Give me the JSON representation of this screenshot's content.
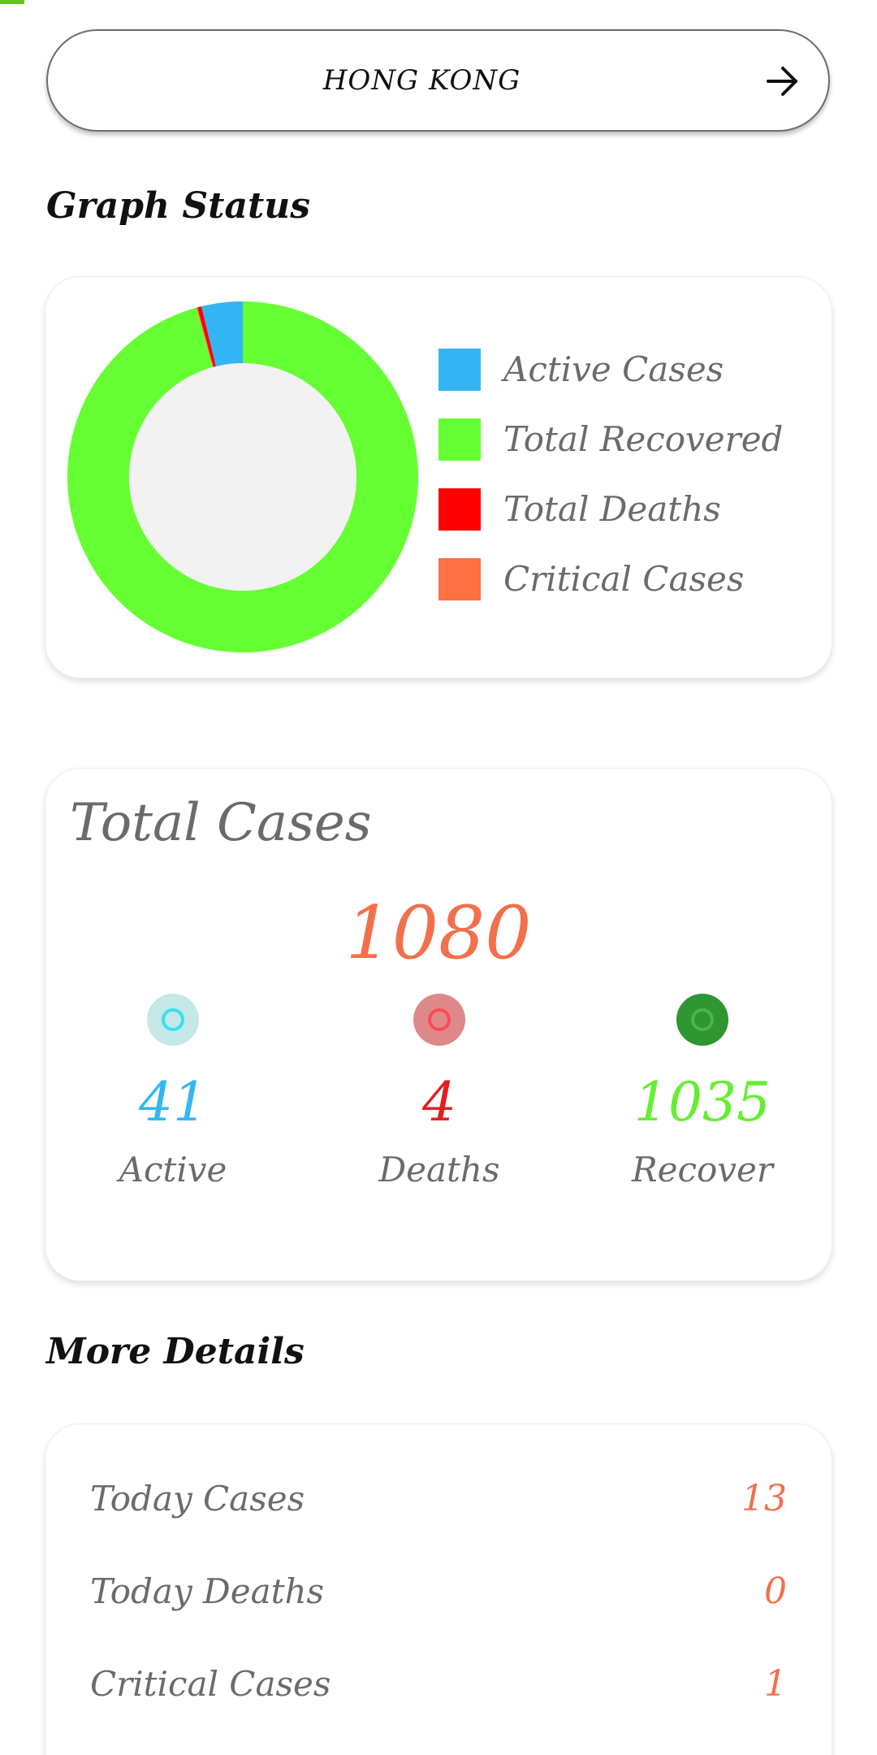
{
  "country_selector": {
    "country": "HONG KONG",
    "arrow_icon": "arrow-right-icon"
  },
  "graph_section": {
    "heading": "Graph Status",
    "legend": [
      {
        "label": "Active Cases",
        "color": "#33b5f5"
      },
      {
        "label": "Total Recovered",
        "color": "#66ff33"
      },
      {
        "label": "Total Deaths",
        "color": "#ff0000"
      },
      {
        "label": "Critical Cases",
        "color": "#ff7043"
      }
    ]
  },
  "chart_data": {
    "type": "pie",
    "donut": true,
    "categories": [
      "Active Cases",
      "Total Recovered",
      "Total Deaths",
      "Critical Cases"
    ],
    "values": [
      41,
      1035,
      4,
      1
    ],
    "colors": [
      "#33b5f5",
      "#66ff33",
      "#ff0000",
      "#ff7043"
    ]
  },
  "total_cases": {
    "title": "Total Cases",
    "value": "1080",
    "active": {
      "value": "41",
      "label": "Active"
    },
    "deaths": {
      "value": "4",
      "label": "Deaths"
    },
    "recover": {
      "value": "1035",
      "label": "Recover"
    }
  },
  "more_details": {
    "heading": "More Details",
    "rows": [
      {
        "label": "Today Cases",
        "value": "13"
      },
      {
        "label": "Today Deaths",
        "value": "0"
      },
      {
        "label": "Critical Cases",
        "value": "1"
      }
    ]
  }
}
